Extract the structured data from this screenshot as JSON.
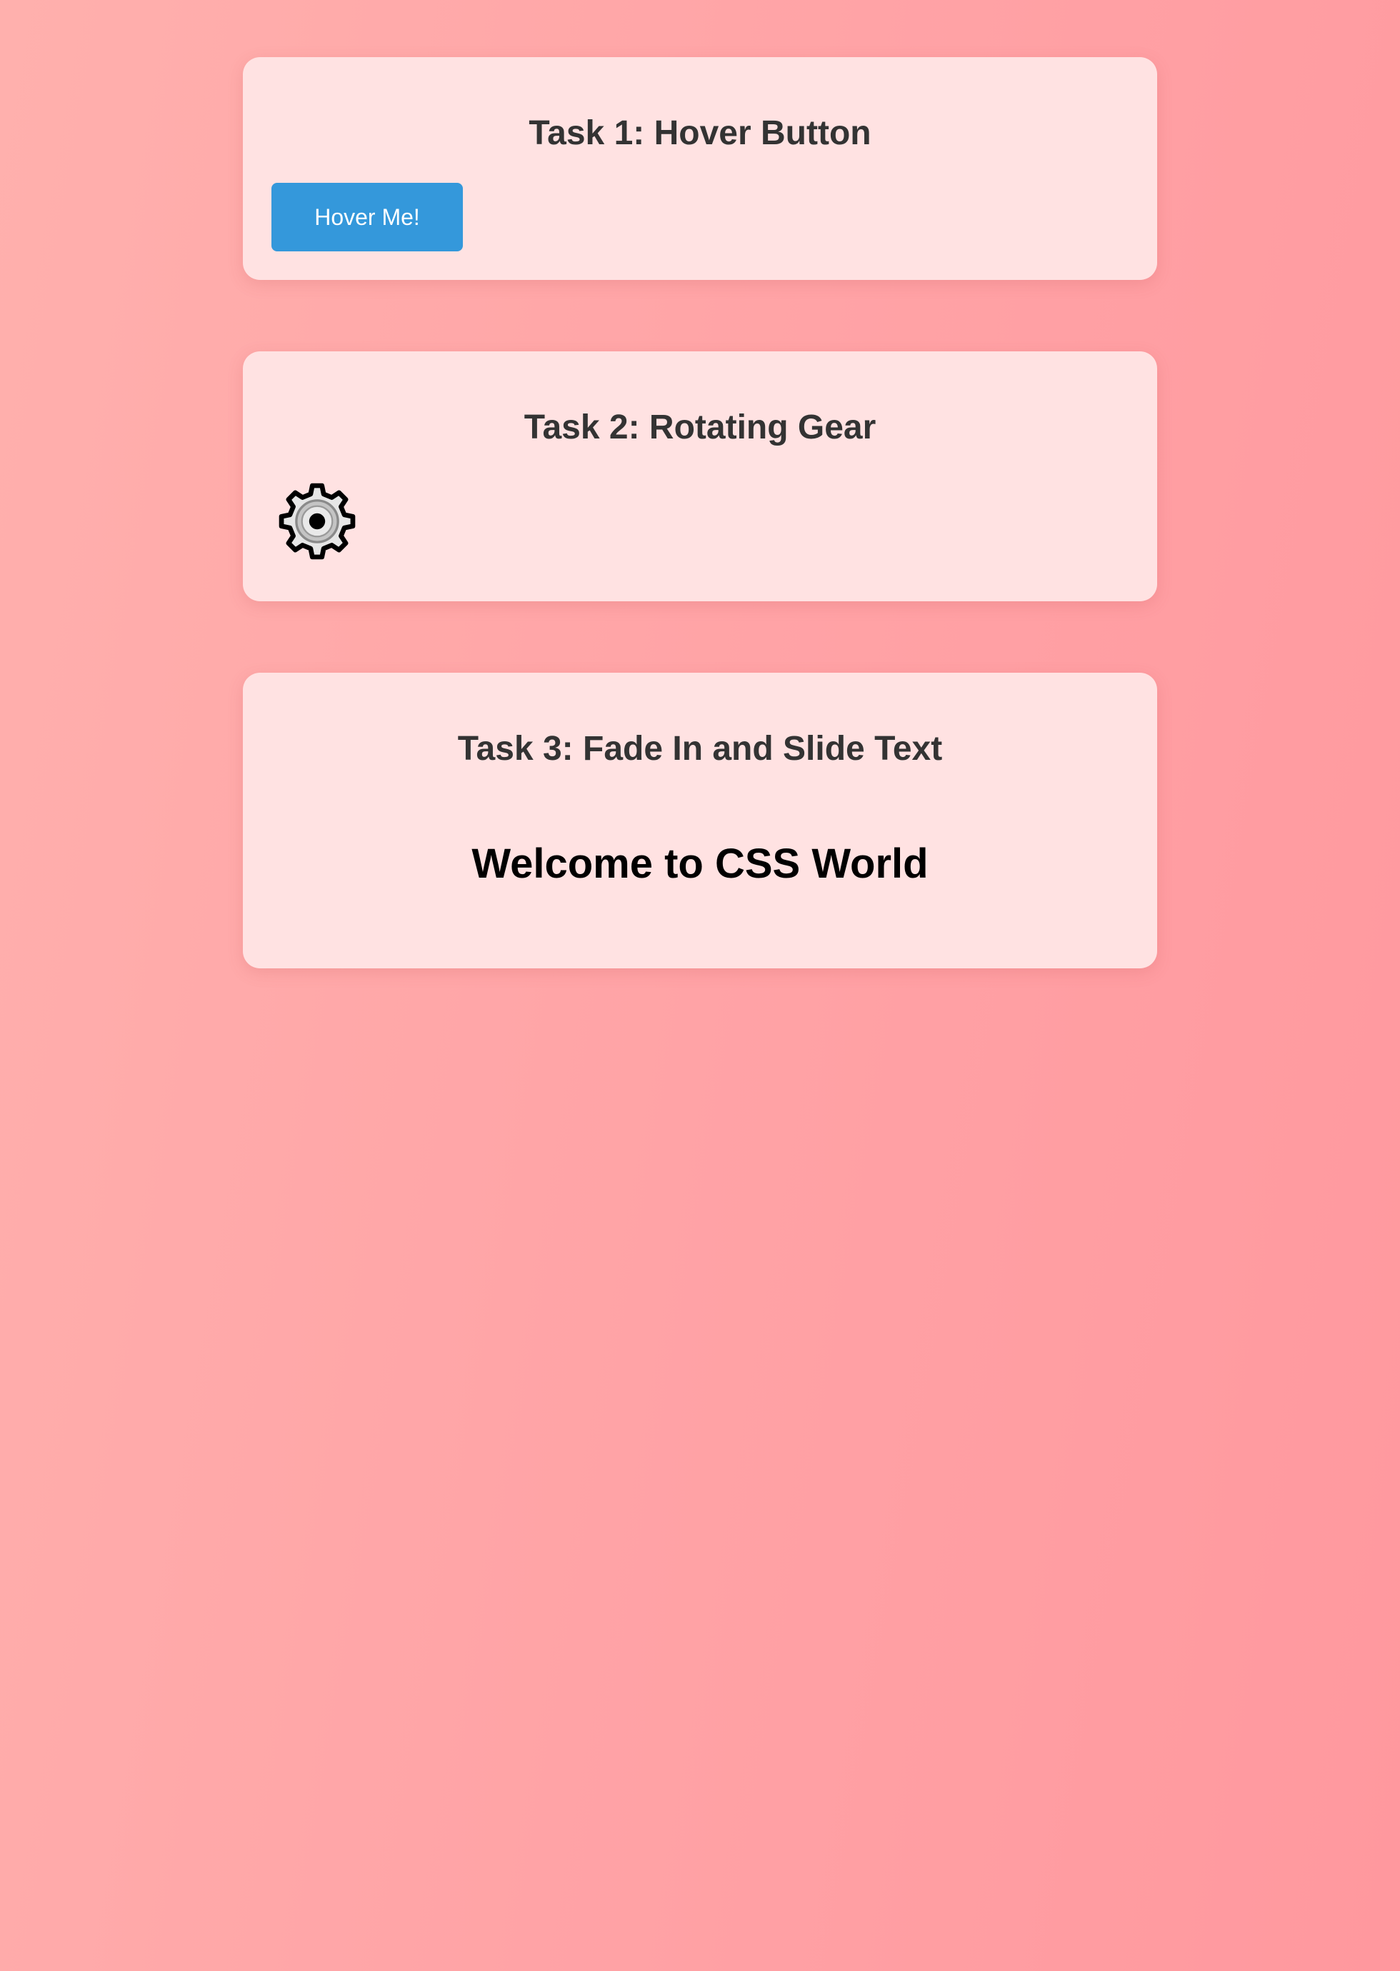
{
  "tasks": [
    {
      "title": "Task 1: Hover Button",
      "button_label": "Hover Me!"
    },
    {
      "title": "Task 2: Rotating Gear",
      "icon": "gear-icon"
    },
    {
      "title": "Task 3: Fade In and Slide Text",
      "text": "Welcome to CSS World"
    }
  ],
  "colors": {
    "background_start": "#ffb0ad",
    "background_end": "#ff989e",
    "card": "#ffe2e2",
    "title": "#333333",
    "button": "#3498db",
    "button_text": "#ffffff"
  }
}
